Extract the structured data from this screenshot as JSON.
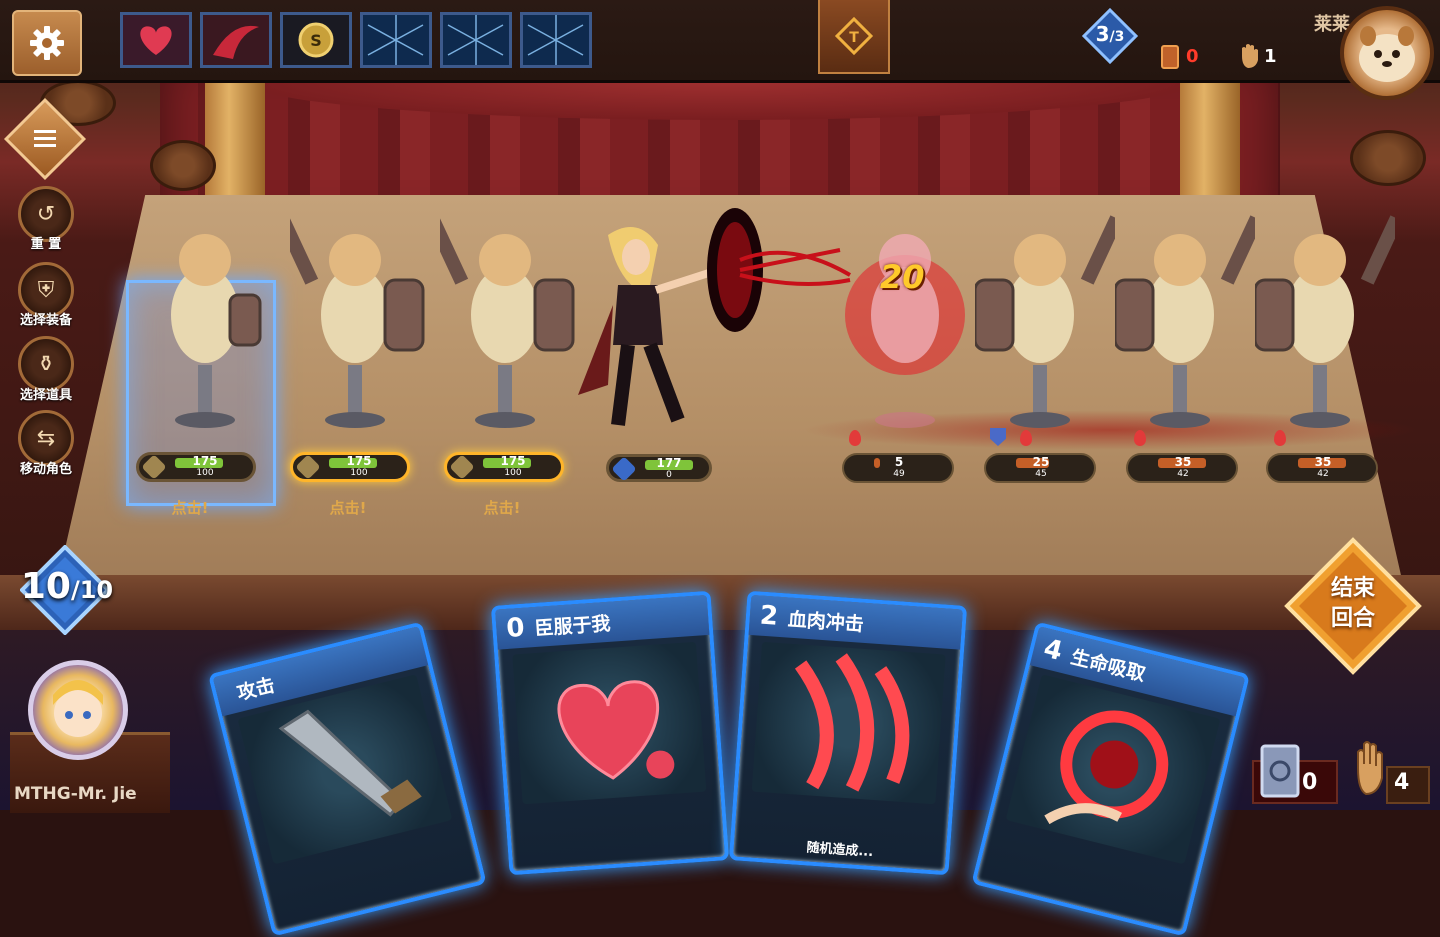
{
  "top": {
    "floor_current": "3",
    "floor_total": "/3",
    "player_name": "莱莱",
    "cards_count": "0",
    "hand_count": "1"
  },
  "relics": [
    {
      "icon": "heart-relic-icon"
    },
    {
      "icon": "blood-sigil-relic-icon"
    },
    {
      "icon": "coin-relic-icon"
    },
    {
      "icon": "locked-relic-icon"
    },
    {
      "icon": "locked-relic-icon"
    },
    {
      "icon": "locked-relic-icon"
    }
  ],
  "side_menu": {
    "reset": "重 置",
    "equip": "选择装备",
    "items": "选择道具",
    "move": "移动角色"
  },
  "allies": [
    {
      "hp": "175",
      "shield": "100",
      "hp_pct": 0.8,
      "click": "点击!",
      "selected": true
    },
    {
      "hp": "175",
      "shield": "100",
      "hp_pct": 0.8,
      "click": "点击!",
      "selected": false
    },
    {
      "hp": "175",
      "shield": "100",
      "hp_pct": 0.8,
      "click": "点击!",
      "selected": false
    }
  ],
  "hero": {
    "hp": "177",
    "sub": "0",
    "hp_pct": 0.8
  },
  "damage_popup": "20",
  "enemies": [
    {
      "hp": "5",
      "sub": "49",
      "hp_pct": 0.1
    },
    {
      "hp": "25",
      "sub": "45",
      "hp_pct": 0.55
    },
    {
      "hp": "35",
      "sub": "42",
      "hp_pct": 0.8
    },
    {
      "hp": "35",
      "sub": "42",
      "hp_pct": 0.8
    }
  ],
  "energy": {
    "current": "10",
    "max": "/10"
  },
  "end_turn": {
    "line1": "结束",
    "line2": "回合"
  },
  "cards": [
    {
      "cost": "",
      "name": "攻击",
      "desc": ""
    },
    {
      "cost": "0",
      "name": "臣服于我",
      "desc": ""
    },
    {
      "cost": "2",
      "name": "血肉冲击",
      "desc": "随机造成..."
    },
    {
      "cost": "4",
      "name": "生命吸取",
      "desc": ""
    }
  ],
  "player": {
    "name": "MTHG-Mr. Jie"
  },
  "piles": {
    "discard": "0",
    "draw": "4"
  },
  "colors": {
    "card_border": "#2a8cff",
    "hp_green": "#7fc43a",
    "gold": "#ffb52a",
    "blood": "#e23a3a"
  }
}
